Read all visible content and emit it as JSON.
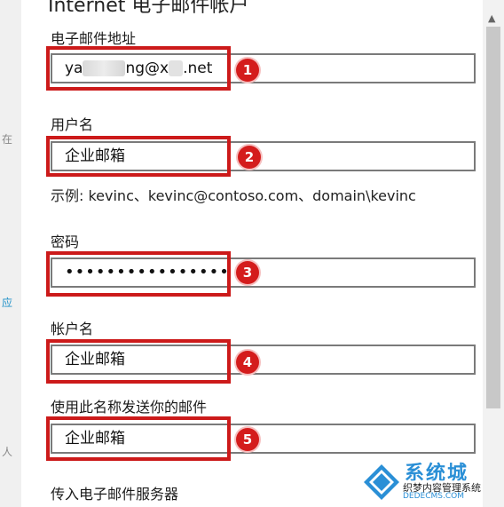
{
  "left_strip": {
    "text_a": "在",
    "text_b": "应",
    "text_c": "人"
  },
  "dialog": {
    "title": "Internet 电子邮件帐户",
    "fields": [
      {
        "label": "电子邮件地址",
        "value_start": "ya",
        "value_mid": "ng@x",
        "value_end": ".net",
        "badge": "1"
      },
      {
        "label": "用户名",
        "value": "企业邮箱",
        "badge": "2"
      },
      {
        "label": "密码",
        "value": "••••••••••••••••",
        "badge": "3"
      },
      {
        "label": "帐户名",
        "value": "企业邮箱",
        "badge": "4"
      },
      {
        "label": "使用此名称发送你的邮件",
        "value": "企业邮箱",
        "badge": "5"
      }
    ],
    "username_hint": "示例: kevinc、kevinc@contoso.com、domain\\kevinc",
    "incoming_server_label": "传入电子邮件服务器"
  },
  "watermark": {
    "big_text": "系统城",
    "sub_text": "织梦内容管理系统",
    "url": "DEDECMS.COM"
  },
  "colors": {
    "highlight": "#cc1a1a",
    "badge": "#d41c1c",
    "input_border": "#7a7a7a",
    "accent": "#1e90c8"
  }
}
